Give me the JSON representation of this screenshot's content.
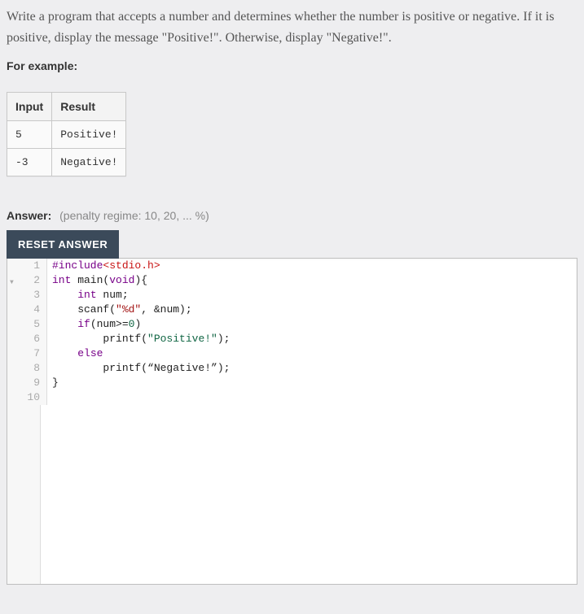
{
  "description": "Write a program that accepts a number and determines whether the number is positive or negative. If it is positive, display the message \"Positive!\". Otherwise, display \"Negative!\".",
  "for_example_label": "For example:",
  "table": {
    "headers": [
      "Input",
      "Result"
    ],
    "rows": [
      {
        "input": "5",
        "result": "Positive!"
      },
      {
        "input": "-3",
        "result": "Negative!"
      }
    ]
  },
  "answer": {
    "label": "Answer:",
    "penalty": "(penalty regime: 10, 20, ... %)"
  },
  "reset_label": "RESET ANSWER",
  "code_lines": [
    {
      "n": "1",
      "tokens": [
        {
          "t": "#include",
          "c": "kw"
        },
        {
          "t": "<stdio.h>",
          "c": "hdr"
        }
      ]
    },
    {
      "n": "2",
      "fold": true,
      "tokens": [
        {
          "t": "int",
          "c": "kw"
        },
        {
          "t": " main("
        },
        {
          "t": "void",
          "c": "kw"
        },
        {
          "t": "){ "
        }
      ]
    },
    {
      "n": "3",
      "tokens": [
        {
          "t": "    "
        },
        {
          "t": "int",
          "c": "kw"
        },
        {
          "t": " num;"
        }
      ]
    },
    {
      "n": "4",
      "tokens": [
        {
          "t": "    scanf("
        },
        {
          "t": "\"%d\"",
          "c": "str"
        },
        {
          "t": ", "
        },
        {
          "t": "&",
          "c": "op"
        },
        {
          "t": "num);"
        }
      ]
    },
    {
      "n": "5",
      "tokens": [
        {
          "t": "    "
        },
        {
          "t": "if",
          "c": "kw"
        },
        {
          "t": "(num"
        },
        {
          "t": ">=",
          "c": "op"
        },
        {
          "t": "0",
          "c": "num"
        },
        {
          "t": ")"
        }
      ]
    },
    {
      "n": "6",
      "tokens": [
        {
          "t": "        printf("
        },
        {
          "t": "\"Positive!\"",
          "c": "strg"
        },
        {
          "t": ");"
        }
      ]
    },
    {
      "n": "7",
      "tokens": [
        {
          "t": "    "
        },
        {
          "t": "else",
          "c": "kw"
        }
      ]
    },
    {
      "n": "8",
      "tokens": [
        {
          "t": "        printf(“Negative"
        },
        {
          "t": "!",
          "c": "op"
        },
        {
          "t": "”);"
        }
      ]
    },
    {
      "n": "9",
      "tokens": [
        {
          "t": "}"
        }
      ]
    },
    {
      "n": "10",
      "tokens": []
    }
  ]
}
